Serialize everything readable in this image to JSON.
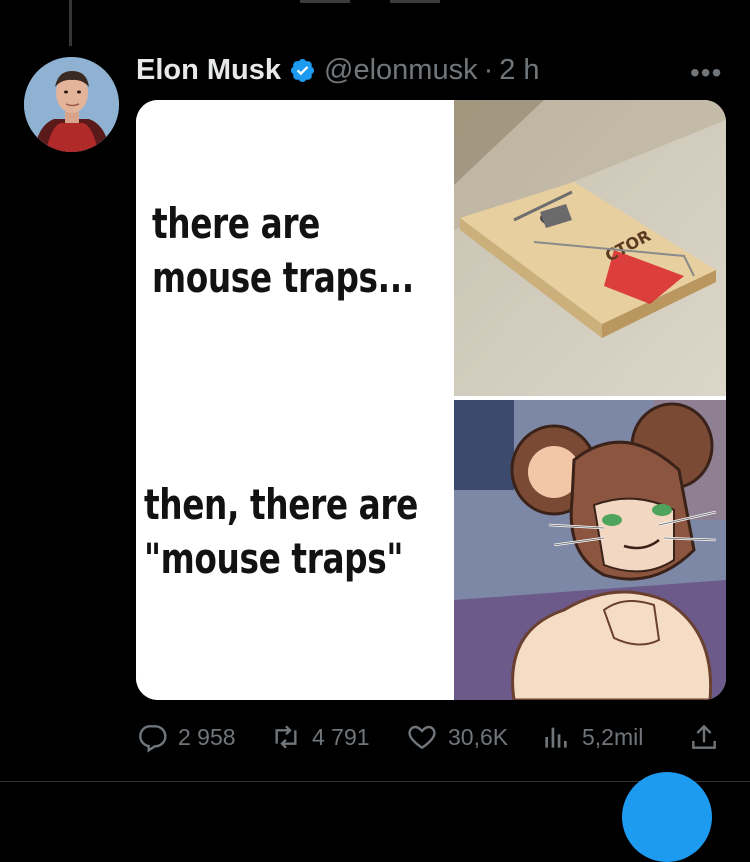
{
  "tweet": {
    "author_name": "Elon Musk",
    "handle": "@elonmusk",
    "separator": "·",
    "time": "2 h",
    "more_label": "•••"
  },
  "media": {
    "caption_top": "there are\nmouse traps...",
    "caption_bottom": "then, there are\n\"mouse traps\""
  },
  "actions": {
    "replies": "2 958",
    "retweets": "4 791",
    "likes": "30,6K",
    "views": "5,2mil"
  },
  "colors": {
    "background": "#000000",
    "text_primary": "#e7e9ea",
    "text_secondary": "#71767b",
    "verified": "#1d9bf0",
    "accent": "#1d9bf0"
  },
  "icons": [
    "verified-badge-icon",
    "more-icon",
    "reply-icon",
    "retweet-icon",
    "like-icon",
    "views-icon",
    "share-icon"
  ]
}
